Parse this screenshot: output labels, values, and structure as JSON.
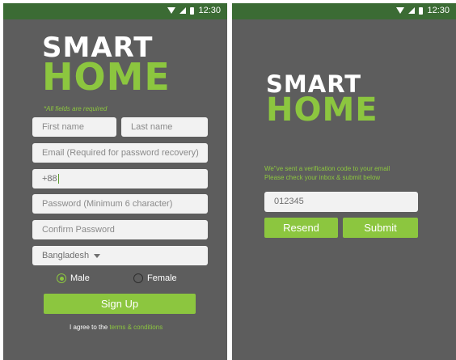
{
  "status_bar": {
    "time": "12:30",
    "icons": [
      "wifi-icon",
      "signal-icon",
      "battery-icon"
    ]
  },
  "signup": {
    "logo": {
      "line1": "SMART",
      "line2": "HOME"
    },
    "required_note": "*All fields are required",
    "first_name_placeholder": "First name",
    "last_name_placeholder": "Last name",
    "email_placeholder": "Email (Required for password recovery)",
    "phone_value": "+88",
    "password_placeholder": "Password (Minimum 6 character)",
    "confirm_placeholder": "Confirm Password",
    "country_value": "Bangladesh",
    "gender_options": [
      {
        "label": "Male",
        "selected": true
      },
      {
        "label": "Female",
        "selected": false
      }
    ],
    "signup_button": "Sign Up",
    "terms_prefix": "I agree to the",
    "terms_link": "terms & conditions"
  },
  "verify": {
    "logo": {
      "line1": "SMART",
      "line2": "HOME"
    },
    "message_line1": "We\"ve sent a verification code to your email",
    "message_line2": "Please check your inbox & submit below",
    "code_value": "012345",
    "resend_button": "Resend",
    "submit_button": "Submit"
  },
  "colors": {
    "accent": "#8cc63f",
    "status_bar": "#3b6b34",
    "background": "#5d5d5d",
    "field": "#f2f2f2"
  }
}
